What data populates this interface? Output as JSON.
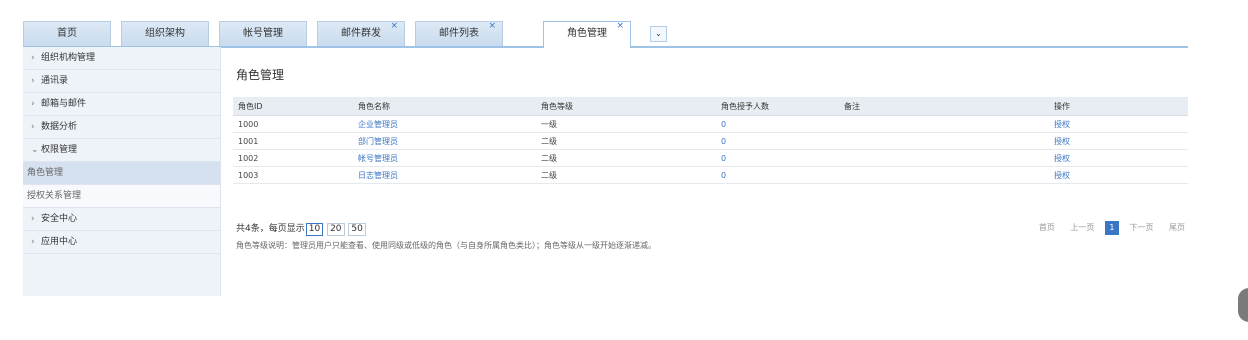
{
  "tabs": [
    {
      "label": "首页",
      "closable": false,
      "active": false
    },
    {
      "label": "组织架构",
      "closable": false,
      "active": false
    },
    {
      "label": "帐号管理",
      "closable": false,
      "active": false
    },
    {
      "label": "邮件群发",
      "closable": true,
      "active": false
    },
    {
      "label": "邮件列表",
      "closable": true,
      "active": false
    },
    {
      "label": "角色管理",
      "closable": true,
      "active": true
    }
  ],
  "tab_close_glyph": "×",
  "tab_more_glyph": "⌄",
  "sidebar": {
    "items": [
      {
        "label": "组织机构管理",
        "chev": "›"
      },
      {
        "label": "通讯录",
        "chev": "›"
      },
      {
        "label": "邮箱与邮件",
        "chev": "›"
      },
      {
        "label": "数据分析",
        "chev": "›"
      },
      {
        "label": "权限管理",
        "chev": "⌄"
      },
      {
        "label": "角色管理",
        "chev": ""
      },
      {
        "label": "授权关系管理",
        "chev": ""
      },
      {
        "label": "安全中心",
        "chev": "›"
      },
      {
        "label": "应用中心",
        "chev": "›"
      }
    ]
  },
  "main": {
    "title": "角色管理",
    "columns": [
      "角色ID",
      "角色名称",
      "角色等级",
      "角色授予人数",
      "备注",
      "操作"
    ],
    "rows": [
      {
        "id": "1000",
        "name": "企业管理员",
        "level": "一级",
        "count": "0",
        "note": "",
        "action": "授权"
      },
      {
        "id": "1001",
        "name": "部门管理员",
        "level": "二级",
        "count": "0",
        "note": "",
        "action": "授权"
      },
      {
        "id": "1002",
        "name": "帐号管理员",
        "level": "二级",
        "count": "0",
        "note": "",
        "action": "授权"
      },
      {
        "id": "1003",
        "name": "日志管理员",
        "level": "二级",
        "count": "0",
        "note": "",
        "action": "授权"
      }
    ],
    "pager": {
      "summary": "共4条，每页显示",
      "sizes": [
        "10",
        "20",
        "50"
      ],
      "first": "首页",
      "prev": "上一页",
      "current": "1",
      "next": "下一页",
      "last": "尾页"
    },
    "note": "角色等级说明：管理员用户只能查看、使用同级或低级的角色（与自身所属角色类比）；角色等级从一级开始逐渐递减。"
  }
}
